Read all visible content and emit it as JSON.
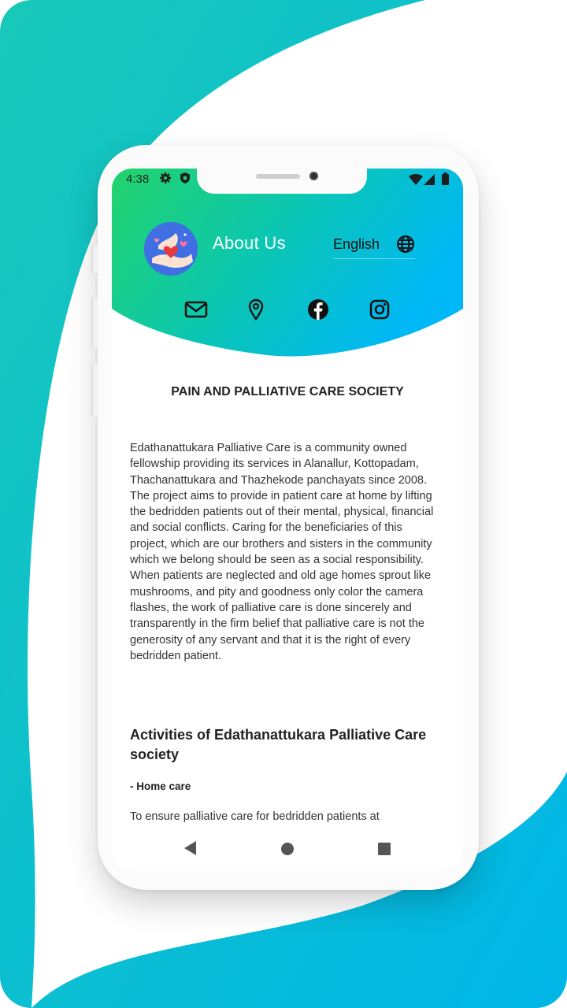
{
  "status_bar": {
    "time": "4:38"
  },
  "header": {
    "title": "About Us",
    "language": "English"
  },
  "social_links": [
    "email-icon",
    "location-pin-icon",
    "facebook-icon",
    "instagram-icon"
  ],
  "content": {
    "heading": "PAIN AND PALLIATIVE CARE SOCIETY",
    "paragraph": "Edathanattukara Palliative Care is a community owned fellowship providing its services in Alanallur, Kottopadam, Thachanattukara and Thazhekode panchayats since 2008. The project aims to provide in patient care at home by lifting the bedridden patients out of their mental, physical, financial and social conflicts. Caring for the beneficiaries of this project, which are our brothers and sisters in the community which we belong should be seen as a social responsibility. When patients are neglected and old age homes sprout like mushrooms, and pity and goodness only color the camera flashes, the work of palliative care is done sincerely and transparently in the firm belief that palliative care is not the generosity of any servant and that it is the right of every bedridden patient.",
    "activities_heading": "Activities of Edathanattukara Palliative Care society",
    "activity_title": "- Home care",
    "activity_text": "To ensure palliative care for bedridden patients at"
  },
  "colors": {
    "gradient_start": "#22d36a",
    "gradient_end": "#00b8f5",
    "background_accent": "#0cbdd8"
  }
}
